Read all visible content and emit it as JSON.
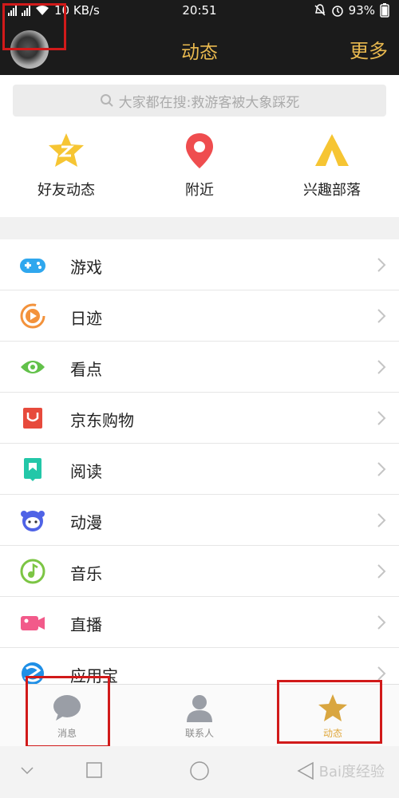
{
  "status_bar": {
    "net": "4G",
    "net2": "3G",
    "speed": "10 KB/s",
    "time": "20:51",
    "battery": "93%"
  },
  "header": {
    "title": "动态",
    "more": "更多"
  },
  "search": {
    "placeholder": "大家都在搜:救游客被大象踩死"
  },
  "quick": [
    {
      "label": "好友动态",
      "icon": "friend-feed-star-icon",
      "color": "#f6c533"
    },
    {
      "label": "附近",
      "icon": "location-pin-icon",
      "color": "#ef4d4f"
    },
    {
      "label": "兴趣部落",
      "icon": "tent-icon",
      "color": "#f6c533"
    }
  ],
  "list": [
    {
      "label": "游戏",
      "icon": "gamepad-icon",
      "color": "#2fa7ee"
    },
    {
      "label": "日迹",
      "icon": "play-circle-icon",
      "color": "#f3923b"
    },
    {
      "label": "看点",
      "icon": "eye-icon",
      "color": "#62c14a"
    },
    {
      "label": "京东购物",
      "icon": "shopping-bag-icon",
      "color": "#e74a3c"
    },
    {
      "label": "阅读",
      "icon": "book-icon",
      "color": "#23c7a8"
    },
    {
      "label": "动漫",
      "icon": "cartoon-face-icon",
      "color": "#4f63e6"
    },
    {
      "label": "音乐",
      "icon": "music-note-icon",
      "color": "#7cc544"
    },
    {
      "label": "直播",
      "icon": "video-camera-icon",
      "color": "#f25a8a"
    },
    {
      "label": "应用宝",
      "icon": "app-store-icon",
      "color": "#1f8fe6"
    }
  ],
  "tabbar": {
    "messages": "消息",
    "contacts": "联系人",
    "feed": "动态"
  },
  "watermark": "Bai度经验",
  "colors": {
    "accent": "#e9b94f",
    "header_bg": "#1b1b1b",
    "highlight_box": "#d11a1a"
  }
}
